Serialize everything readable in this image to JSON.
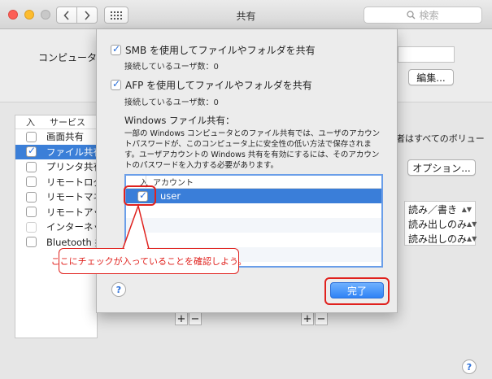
{
  "window": {
    "title": "共有",
    "search_placeholder": "検索"
  },
  "background": {
    "computer_label": "コンピュータ",
    "edit_button": "編集...",
    "options_button": "オプション...",
    "right_note": "者はすべてのボリュー",
    "service_list": {
      "header_on": "入",
      "header_service": "サービス",
      "rows": [
        {
          "label": "画面共有",
          "checked": false
        },
        {
          "label": "ファイル共有",
          "checked": true,
          "selected": true
        },
        {
          "label": "プリンタ共有",
          "checked": false
        },
        {
          "label": "リモートログイン",
          "checked": false
        },
        {
          "label": "リモートマネジメント",
          "checked": false
        },
        {
          "label": "リモートアップルイベント",
          "checked": false
        },
        {
          "label": "インターネット共有",
          "checked": false,
          "disabled": true
        },
        {
          "label": "Bluetooth 共有",
          "checked": false
        }
      ]
    },
    "permissions": [
      "読み／書き",
      "読み出しのみ",
      "読み出しのみ"
    ],
    "plus": "+",
    "minus": "−"
  },
  "sheet": {
    "smb_label": "SMB を使用してファイルやフォルダを共有",
    "smb_users": "接続しているユーザ数：0",
    "afp_label": "AFP を使用してファイルやフォルダを共有",
    "afp_users": "接続しているユーザ数：0",
    "windows_title": "Windows ファイル共有：",
    "windows_desc": "一部の Windows コンピュータとのファイル共有では、ユーザのアカウントパスワードが、このコンピュータ上に安全性の低い方法で保存されます。ユーザアカウントの Windows 共有を有効にするには、そのアカウントのパスワードを入力する必要があります。",
    "table_header_on": "入",
    "table_header_account": "アカウント",
    "accounts": [
      {
        "name": "user",
        "checked": true
      }
    ],
    "help": "?",
    "done_button": "完了"
  },
  "annotation": {
    "callout_text": "ここにチェックが入っていることを確認しよう。",
    "color": "#e0211d"
  },
  "bottom_help": "?"
}
